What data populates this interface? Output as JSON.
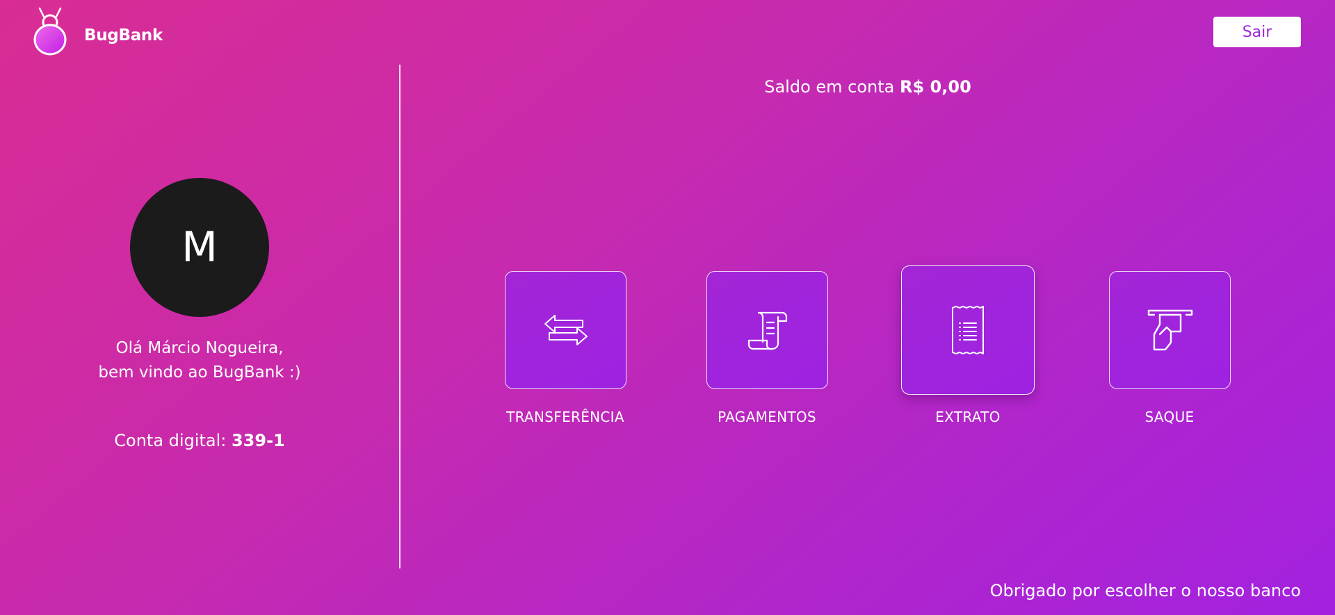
{
  "header": {
    "brand_name": "BugBank",
    "logout_label": "Sair",
    "logo_icon": "bug-logo-icon"
  },
  "balance": {
    "label": "Saldo em conta",
    "value": "R$ 0,00"
  },
  "profile": {
    "avatar_initial": "M",
    "greeting_line1": "Olá Márcio Nogueira,",
    "greeting_line2": "bem vindo ao BugBank :)",
    "account_label": "Conta digital:",
    "account_number": "339-1"
  },
  "actions": [
    {
      "label": "TRANSFERÊNCIA",
      "icon": "transfer-arrows-icon"
    },
    {
      "label": "PAGAMENTOS",
      "icon": "payment-scroll-icon"
    },
    {
      "label": "EXTRATO",
      "icon": "receipt-icon"
    },
    {
      "label": "SAQUE",
      "icon": "cash-withdraw-icon"
    }
  ],
  "footer": {
    "text": "Obrigado por escolher o nosso banco"
  },
  "colors": {
    "gradient_start": "#d92c94",
    "gradient_end": "#a322e0",
    "card_fill": "#a024dc",
    "avatar_bg": "#1b1b1b",
    "button_text": "#9c28d9"
  }
}
